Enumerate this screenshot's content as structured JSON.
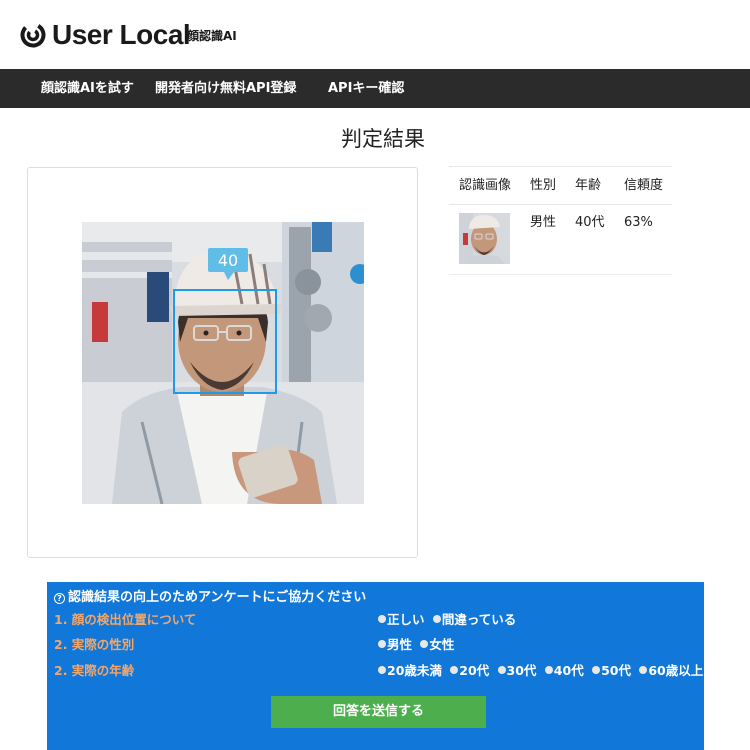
{
  "header": {
    "brand": "User Local",
    "product": "顔認識AI"
  },
  "nav": {
    "items": [
      {
        "label": "顔認識AIを試す"
      },
      {
        "label": "開発者向け無料API登録"
      },
      {
        "label": "APIキー確認"
      }
    ]
  },
  "page": {
    "title": "判定結果"
  },
  "detection": {
    "age_bubble": "40",
    "box_color": "#1e9be8"
  },
  "results": {
    "headers": [
      "認識画像",
      "性別",
      "年齢",
      "信頼度"
    ],
    "rows": [
      {
        "gender": "男性",
        "age": "40代",
        "confidence": "63%"
      }
    ]
  },
  "survey": {
    "title": "認識結果の向上のためアンケートにご協力ください",
    "questions": [
      {
        "label": "1. 顔の検出位置について",
        "options": [
          "正しい",
          "間違っている"
        ]
      },
      {
        "label": "2. 実際の性別",
        "options": [
          "男性",
          "女性"
        ]
      },
      {
        "label": "2. 実際の年齢",
        "options": [
          "20歳未満",
          "20代",
          "30代",
          "40代",
          "50代",
          "60歳以上"
        ]
      }
    ],
    "submit_label": "回答を送信する",
    "background_color": "#1177d8",
    "question_color": "#f2a66a",
    "button_color": "#4cae4c"
  }
}
